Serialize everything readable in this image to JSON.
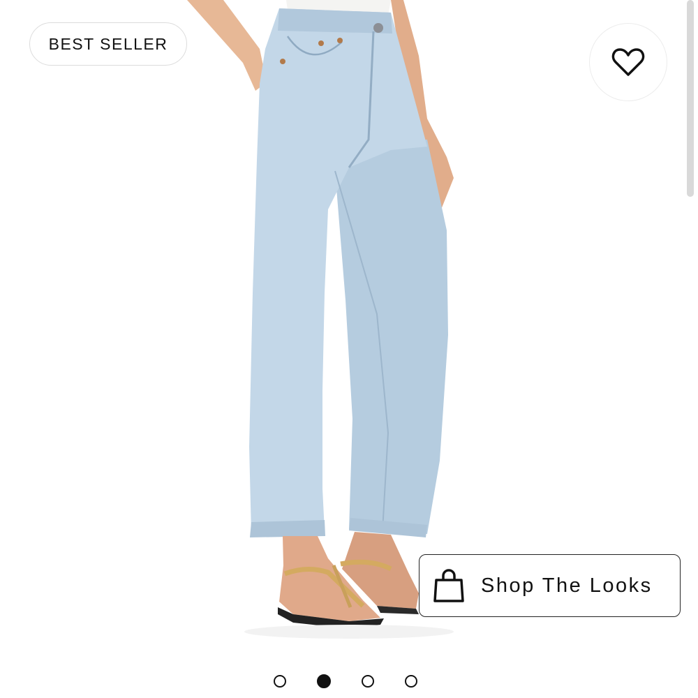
{
  "badge": {
    "label": "BEST SELLER"
  },
  "wishlist": {
    "icon": "heart-icon"
  },
  "shop_the_looks": {
    "label": "Shop The Looks",
    "icon": "shopping-bag-icon"
  },
  "carousel": {
    "total": 4,
    "active_index": 1
  },
  "product_image": {
    "subject": "light-wash straight leg jeans"
  },
  "colors": {
    "denim": "#bcd2e6",
    "background": "#ffffff",
    "text": "#111111"
  }
}
